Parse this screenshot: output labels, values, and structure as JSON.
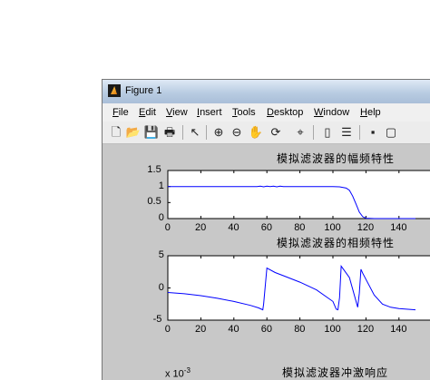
{
  "window": {
    "title": "Figure 1"
  },
  "menu": [
    "File",
    "Edit",
    "View",
    "Insert",
    "Tools",
    "Desktop",
    "Window",
    "Help"
  ],
  "toolbar": [
    {
      "name": "new-figure-icon",
      "glyph": "🗋"
    },
    {
      "name": "open-file-icon",
      "glyph": "📂"
    },
    {
      "name": "save-icon",
      "glyph": "💾"
    },
    {
      "name": "print-icon",
      "glyph": "🖶"
    },
    {
      "name": "edit-plot-arrow-icon",
      "glyph": "↖"
    },
    {
      "name": "zoom-in-icon",
      "glyph": "⊕"
    },
    {
      "name": "zoom-out-icon",
      "glyph": "⊖"
    },
    {
      "name": "pan-hand-icon",
      "glyph": "✋"
    },
    {
      "name": "rotate-3d-icon",
      "glyph": "⟳"
    },
    {
      "name": "data-cursor-icon",
      "glyph": "⌖"
    },
    {
      "name": "colorbar-icon",
      "glyph": "▯"
    },
    {
      "name": "legend-icon",
      "glyph": "☰"
    },
    {
      "name": "hide-plot-tools-icon",
      "glyph": "▪"
    },
    {
      "name": "show-plot-tools-icon",
      "glyph": "▢"
    }
  ],
  "colors": {
    "line": "#0000ff",
    "axes_bg": "#ffffff",
    "figure_bg": "#c8c8c8"
  },
  "chart_data": [
    {
      "type": "line",
      "title": "模拟滤波器的幅频特性",
      "xlim": [
        0,
        150
      ],
      "ylim": [
        0,
        1.5
      ],
      "xticks": [
        "0",
        "20",
        "40",
        "60",
        "80",
        "100",
        "120",
        "140"
      ],
      "yticks": [
        "0",
        "0.5",
        "1",
        "1.5"
      ],
      "series": [
        {
          "x": [
            0,
            54,
            56,
            58,
            60,
            62,
            64,
            66,
            68,
            70,
            100,
            104,
            108,
            110,
            112,
            114,
            116,
            118,
            120,
            125,
            150
          ],
          "y": [
            1,
            1,
            1.01,
            0.99,
            1.01,
            1.0,
            1.01,
            0.99,
            1.01,
            1,
            1,
            0.99,
            0.95,
            0.88,
            0.7,
            0.45,
            0.2,
            0.06,
            0.01,
            0,
            0
          ]
        }
      ]
    },
    {
      "type": "line",
      "title": "模拟滤波器的相频特性",
      "xlim": [
        0,
        150
      ],
      "ylim": [
        -5,
        5
      ],
      "xticks": [
        "0",
        "20",
        "40",
        "60",
        "80",
        "100",
        "120",
        "140"
      ],
      "yticks": [
        "-5",
        "0",
        "5"
      ],
      "series": [
        {
          "x": [
            0,
            10,
            20,
            30,
            40,
            50,
            55,
            57.5,
            58,
            60,
            65,
            70,
            80,
            90,
            100,
            102,
            103,
            104,
            105,
            110,
            115,
            116,
            117,
            118,
            125,
            130,
            135,
            140,
            150
          ],
          "y": [
            -0.7,
            -0.9,
            -1.2,
            -1.6,
            -2.1,
            -2.7,
            -3.1,
            -3.4,
            -2.5,
            3.1,
            2.4,
            1.9,
            0.9,
            -0.3,
            -2.1,
            -3.3,
            -3.4,
            -1.5,
            3.4,
            1.6,
            -3.0,
            -0.8,
            2.9,
            2.3,
            -1.1,
            -2.5,
            -3.0,
            -3.2,
            -3.4
          ]
        }
      ]
    },
    {
      "type": "line",
      "title": "模拟滤波器冲激响应",
      "exponent_label": "x 10",
      "exponent_power": "-3",
      "series": []
    }
  ]
}
